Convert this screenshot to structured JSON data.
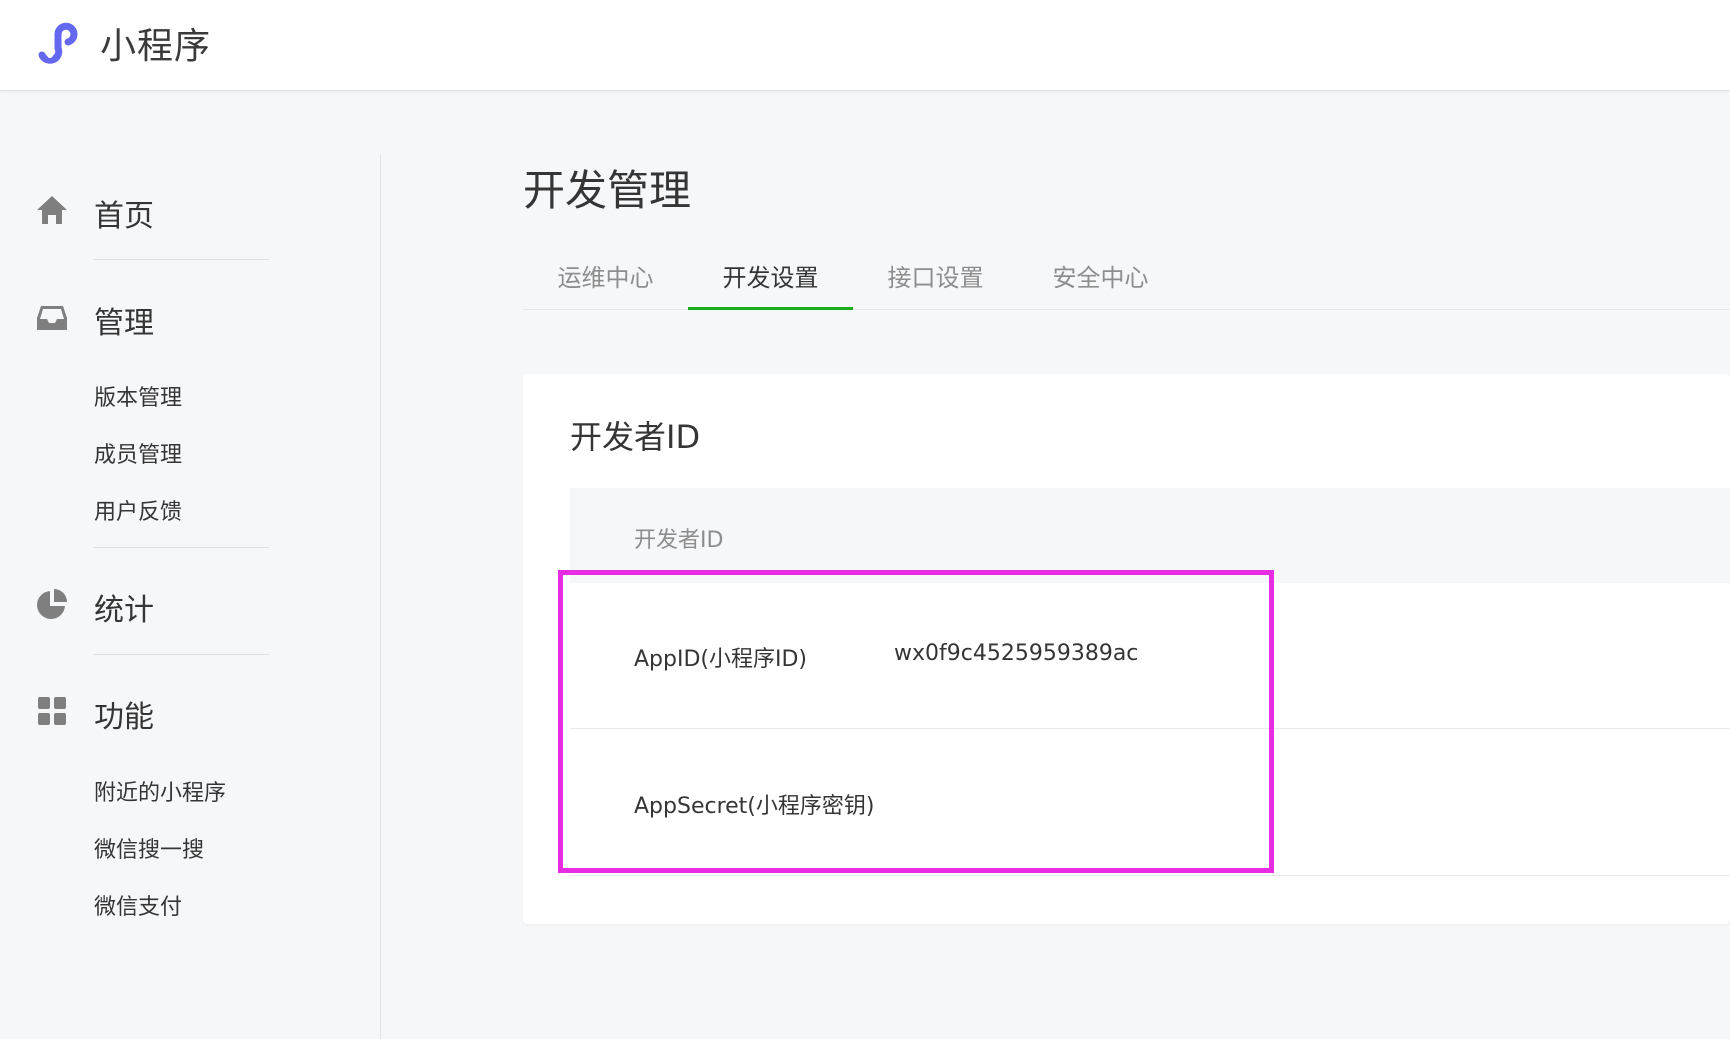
{
  "header": {
    "app_name": "小程序",
    "logo_icon": "miniprogram-logo-icon",
    "brand_color": "#6467f0"
  },
  "sidebar": {
    "groups": [
      {
        "label": "首页",
        "icon": "home-icon",
        "items": []
      },
      {
        "label": "管理",
        "icon": "inbox-icon",
        "items": [
          "版本管理",
          "成员管理",
          "用户反馈"
        ]
      },
      {
        "label": "统计",
        "icon": "pie-chart-icon",
        "items": []
      },
      {
        "label": "功能",
        "icon": "grid-icon",
        "items": [
          "附近的小程序",
          "微信搜一搜",
          "微信支付"
        ]
      }
    ]
  },
  "main": {
    "title": "开发管理",
    "tabs": [
      {
        "label": "运维中心",
        "active": false
      },
      {
        "label": "开发设置",
        "active": true
      },
      {
        "label": "接口设置",
        "active": false
      },
      {
        "label": "安全中心",
        "active": false
      }
    ],
    "active_tab_color": "#1aad19",
    "card": {
      "title": "开发者ID",
      "table_header": "开发者ID",
      "rows": [
        {
          "label": "AppID(小程序ID)",
          "value": "wx0f9c4525959389ac"
        },
        {
          "label": "AppSecret(小程序密钥)",
          "value": ""
        }
      ]
    }
  },
  "highlight_color": "#e82ce2"
}
